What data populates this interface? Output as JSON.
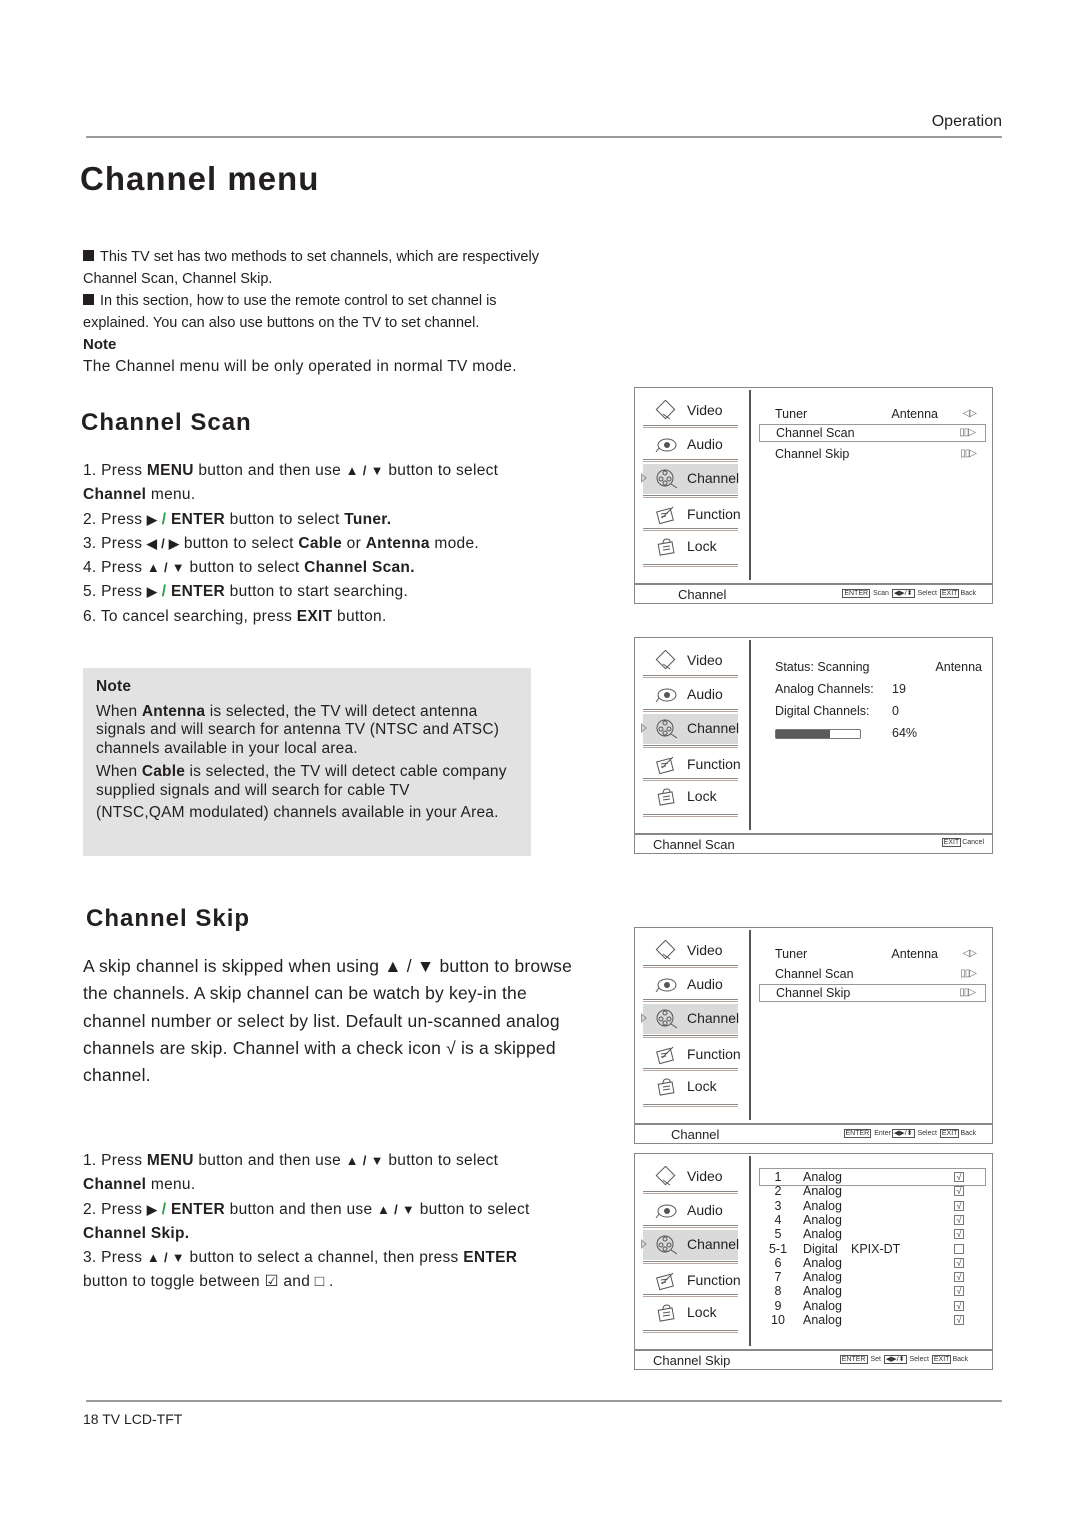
{
  "header": {
    "section_label": "Operation",
    "title": "Channel menu"
  },
  "intro": {
    "bullet1": "This TV set has two methods to set channels, which are respectively Channel Scan,  Channel Skip.",
    "bullet2": "In this section, how to use the remote control  to set channel is explained. You can also use buttons on the TV  to set channel.",
    "note_label": "Note",
    "note_text": "The Channel menu will be only operated  in normal TV mode."
  },
  "channel_scan": {
    "title": "Channel Scan",
    "steps": [
      {
        "pre": "1. Press ",
        "b1": "MENU",
        "mid": " button and then use ",
        "sym": "▲ / ▼",
        "post": " button to select ",
        "b2": "Channel",
        "end": " menu."
      },
      {
        "pre": "2. Press ",
        "sym": "▶",
        "slash": " / ",
        "b1": "ENTER",
        "post": " button to select ",
        "b2": "Tuner."
      },
      {
        "pre": "3. Press ",
        "sym": "◀ / ▶",
        "post": " button to select ",
        "b1": "Cable",
        "mid": " or ",
        "b2": "Antenna",
        "end": "  mode."
      },
      {
        "pre": "4. Press ",
        "sym": "▲ / ▼",
        "post": " button to select ",
        "b1": "Channel Scan."
      },
      {
        "pre": "5. Press ",
        "sym": "▶",
        "slash": "  / ",
        "b1": "ENTER",
        "post": " button to start searching."
      },
      {
        "pre": "6. To cancel searching, press ",
        "b1": "EXIT",
        "post": " button."
      }
    ],
    "note": {
      "title": "Note",
      "p1_pre": "When ",
      "p1_bold": "Antenna",
      "p1_post": "  is selected, the TV will detect antenna signals and will search for antenna TV (NTSC and ATSC) channels available in your local area.",
      "p2_pre": "When ",
      "p2_bold": "Cable",
      "p2_post": " is selected, the TV will detect cable company supplied signals and will search for cable TV",
      "p3": "(NTSC,QAM modulated) channels available in your Area."
    }
  },
  "channel_skip": {
    "title": "Channel Skip",
    "description": "A skip channel is skipped when using ▲ / ▼ button to browse the channels. A skip channel can be watch by key-in the channel number or select by list. Default un-scanned analog channels are skip. Channel with a check icon √ is a skipped channel.",
    "steps": [
      {
        "pre": "1. Press ",
        "b1": "MENU",
        "mid": " button and then use ",
        "sym": "▲ / ▼",
        "post": " button to select ",
        "b2": "Channel",
        "end": " menu."
      },
      {
        "pre": "2. Press ",
        "sym": "▶",
        "slash": " / ",
        "b1": "ENTER",
        "mid": " button and then use ",
        "sym2": "▲ / ▼",
        "post": " button to select ",
        "b2": "Channel Skip."
      },
      {
        "pre": "3. Press ",
        "sym": "▲ / ▼",
        "post": " button to select a channel, then press ",
        "b1": "ENTER",
        "end": " button to toggle between ☑  and □  ."
      }
    ]
  },
  "tv_menu": {
    "sidebar": [
      "Video",
      "Audio",
      "Channel",
      "Function",
      "Lock"
    ],
    "selected_sidebar": "Channel",
    "screen1": {
      "rows": [
        {
          "label": "Tuner",
          "value": "Antenna",
          "arrow": "◁▷"
        },
        {
          "label": "Channel Scan",
          "value": "",
          "arrow": "▯▯▷"
        },
        {
          "label": "Channel Skip",
          "value": "",
          "arrow": "▯▯▷"
        }
      ],
      "highlighted": "Channel Scan",
      "footer_title": "Channel",
      "hint": {
        "k1": "ENTER",
        "a1": "Scan",
        "k2": "◀▶/⬍",
        "a2": "Select",
        "k3": "EXIT",
        "a3": "Back"
      }
    },
    "screen2": {
      "status_label": "Status: Scanning",
      "tuner_value": "Antenna",
      "analog_label": "Analog Channels:",
      "analog_value": "19",
      "digital_label": "Digital Channels:",
      "digital_value": "0",
      "progress_percent": 64,
      "progress_text": "64%",
      "footer_title": "Channel Scan",
      "hint": {
        "k1": "EXIT",
        "a1": "Cancel"
      }
    },
    "screen3": {
      "rows": [
        {
          "label": "Tuner",
          "value": "Antenna",
          "arrow": "◁▷"
        },
        {
          "label": "Channel Scan",
          "value": "",
          "arrow": "▯▯▷"
        },
        {
          "label": "Channel Skip",
          "value": "",
          "arrow": "▯▯▷"
        }
      ],
      "highlighted": "Channel Skip",
      "footer_title": "Channel",
      "hint": {
        "k1": "ENTER",
        "a1": "Enter",
        "k2": "◀▶/⬍",
        "a2": "Select",
        "k3": "EXIT",
        "a3": "Back"
      }
    },
    "screen4": {
      "channels": [
        {
          "num": "1",
          "type": "Analog",
          "name": "",
          "skipped": true
        },
        {
          "num": "2",
          "type": "Analog",
          "name": "",
          "skipped": true
        },
        {
          "num": "3",
          "type": "Analog",
          "name": "",
          "skipped": true
        },
        {
          "num": "4",
          "type": "Analog",
          "name": "",
          "skipped": true
        },
        {
          "num": "5",
          "type": "Analog",
          "name": "",
          "skipped": true
        },
        {
          "num": "5-1",
          "type": "Digital",
          "name": "KPIX-DT",
          "skipped": false
        },
        {
          "num": "6",
          "type": "Analog",
          "name": "",
          "skipped": true
        },
        {
          "num": "7",
          "type": "Analog",
          "name": "",
          "skipped": true
        },
        {
          "num": "8",
          "type": "Analog",
          "name": "",
          "skipped": true
        },
        {
          "num": "9",
          "type": "Analog",
          "name": "",
          "skipped": true
        },
        {
          "num": "10",
          "type": "Analog",
          "name": "",
          "skipped": true
        }
      ],
      "footer_title": "Channel Skip",
      "hint": {
        "k1": "ENTER",
        "a1": "Set",
        "k2": "◀▶/⬍",
        "a2": "Select",
        "k3": "EXIT",
        "a3": "Back"
      }
    }
  },
  "footer": {
    "page_label": "18  TV LCD-TFT"
  }
}
